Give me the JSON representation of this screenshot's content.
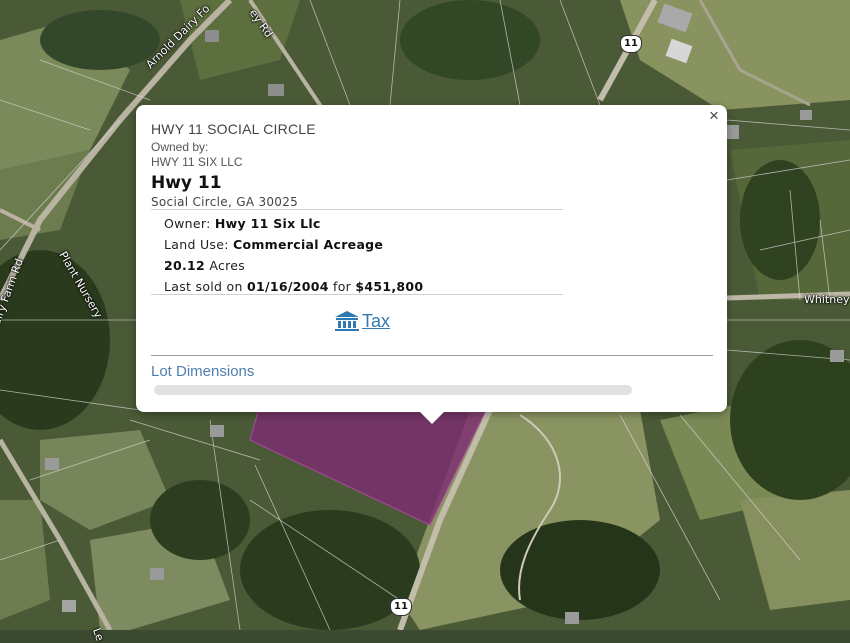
{
  "map": {
    "road_labels": [
      "Arnold Dairy Fo",
      "ey Rd",
      "Plant Nursery",
      "airy Farm Rd",
      "Whitney",
      "Le"
    ],
    "highway_shields": [
      "11",
      "11"
    ],
    "parcel_highlight_color": "#7d2a73"
  },
  "popup": {
    "close_label": "×",
    "title": "HWY 11 SOCIAL CIRCLE",
    "owned_by_label": "Owned by:",
    "owner_name": "HWY 11 SIX LLC",
    "address": "Hwy 11",
    "city": "Social Circle, GA 30025",
    "owner_label": "Owner:",
    "owner_value": "Hwy 11 Six Llc",
    "land_use_label": "Land Use:",
    "land_use_value": "Commercial Acreage",
    "acres_value": "20.12",
    "acres_label": "Acres",
    "last_sold_label": "Last sold on",
    "last_sold_date": "01/16/2004",
    "for_label": "for",
    "last_sold_price": "$451,800",
    "tax_label": "Tax",
    "tax_icon": "bank-icon",
    "lot_dimensions_label": "Lot Dimensions",
    "link_color": "#2f7ab3"
  }
}
